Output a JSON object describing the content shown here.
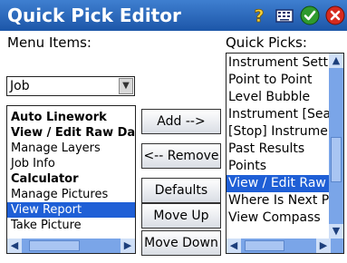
{
  "window": {
    "title": "Quick Pick Editor"
  },
  "titlebar_icons": [
    "help-icon",
    "keyboard-icon",
    "ok-icon",
    "close-icon"
  ],
  "menu_items": {
    "label": "Menu Items:",
    "combo_value": "Job",
    "list": [
      {
        "text": "Auto Linework",
        "bold": true
      },
      {
        "text": "View / Edit Raw Data",
        "bold": true
      },
      {
        "text": "Manage Layers",
        "bold": false
      },
      {
        "text": "Job Info",
        "bold": false
      },
      {
        "text": "Calculator",
        "bold": true
      },
      {
        "text": "Manage Pictures",
        "bold": false
      },
      {
        "text": "View Report",
        "bold": false,
        "selected": true
      },
      {
        "text": "Take Picture",
        "bold": false
      }
    ]
  },
  "buttons": {
    "add": "Add -->",
    "remove": "<-- Remove",
    "defaults": "Defaults",
    "move_up": "Move Up",
    "move_down": "Move Down"
  },
  "quick_picks": {
    "label": "Quick Picks:",
    "list": [
      {
        "text": "Instrument Settings"
      },
      {
        "text": "Point to Point"
      },
      {
        "text": "Level Bubble"
      },
      {
        "text": "Instrument [Search]"
      },
      {
        "text": "[Stop] Instrument"
      },
      {
        "text": "Past Results"
      },
      {
        "text": "Points"
      },
      {
        "text": "View / Edit Raw Data",
        "selected": true
      },
      {
        "text": "Where Is Next Point"
      },
      {
        "text": "View Compass"
      }
    ]
  },
  "colors": {
    "titlebar": "#2a66bd",
    "selection": "#1f5fd6",
    "scrollbar": "#7aa5e8"
  }
}
